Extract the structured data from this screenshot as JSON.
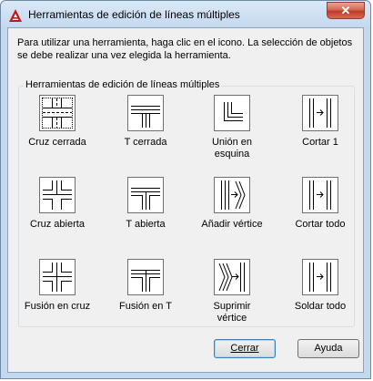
{
  "window": {
    "title": "Herramientas de edición de líneas múltiples",
    "close_glyph": "✕"
  },
  "instructions": "Para utilizar una herramienta, haga clic en el icono. La selección de objetos se debe realizar una vez elegida la herramienta.",
  "group": {
    "label": "Herramientas de edición de líneas múltiples"
  },
  "tools": [
    {
      "label": "Cruz cerrada",
      "icon": "closed-cross-icon"
    },
    {
      "label": "T cerrada",
      "icon": "closed-tee-icon"
    },
    {
      "label": "Unión en\nesquina",
      "icon": "corner-joint-icon"
    },
    {
      "label": "Cortar 1",
      "icon": "cut-single-icon"
    },
    {
      "label": "Cruz abierta",
      "icon": "open-cross-icon"
    },
    {
      "label": "T abierta",
      "icon": "open-tee-icon"
    },
    {
      "label": "Añadir vértice",
      "icon": "add-vertex-icon"
    },
    {
      "label": "Cortar todo",
      "icon": "cut-all-icon"
    },
    {
      "label": "Fusión en cruz",
      "icon": "merged-cross-icon"
    },
    {
      "label": "Fusión en T",
      "icon": "merged-tee-icon"
    },
    {
      "label": "Suprimir\nvértice",
      "icon": "delete-vertex-icon"
    },
    {
      "label": "Soldar todo",
      "icon": "weld-all-icon"
    }
  ],
  "buttons": {
    "close_label": "Cerrar",
    "help_label": "Ayuda"
  }
}
